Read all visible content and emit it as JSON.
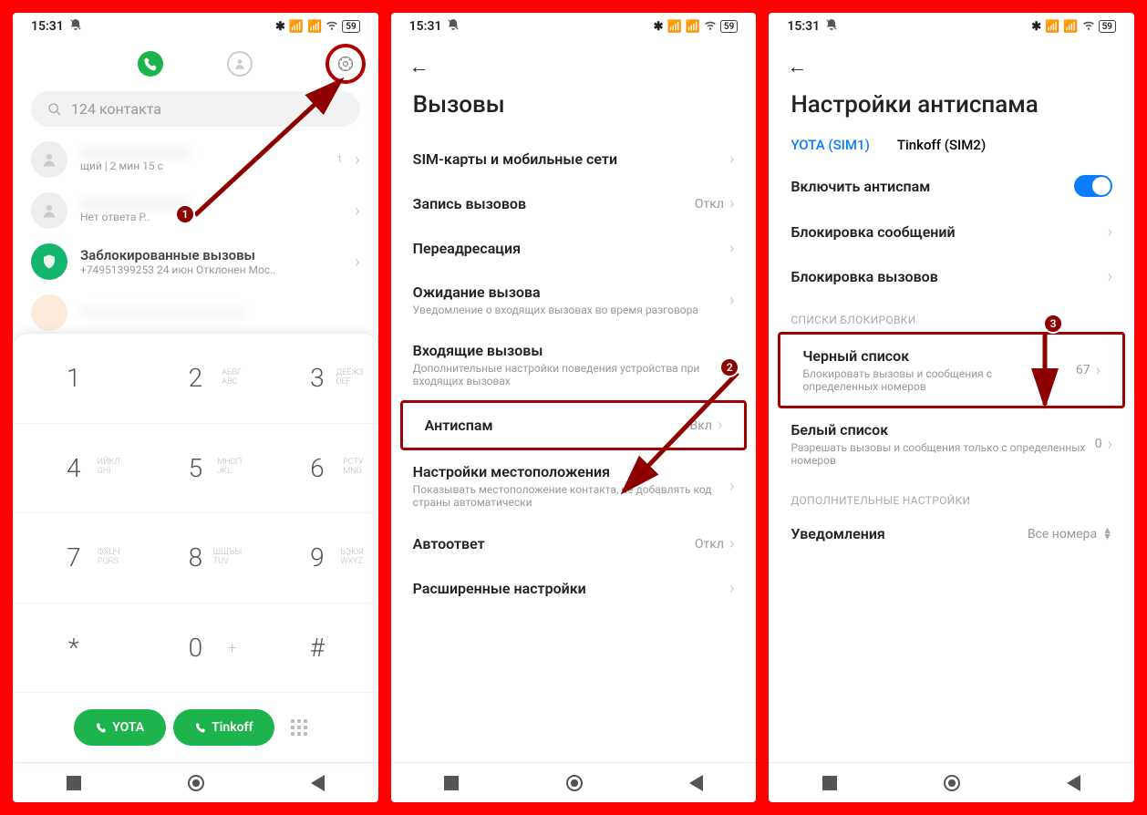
{
  "status": {
    "time": "15:31",
    "battery": "59"
  },
  "screen1": {
    "search_placeholder": "124 контакта",
    "recent1_sub": "щий | 2 мин 15 с",
    "recent2_sub": "Нет ответа  Р..",
    "blocked_title": "Заблокированные вызовы",
    "blocked_sub": "+74951399253  24 июн Отклонен  Мос..",
    "keys": [
      {
        "n": "1",
        "l": ""
      },
      {
        "n": "2",
        "l": "АБВГ\nABC"
      },
      {
        "n": "3",
        "l": "ДЕЁЖЗ\nDEF"
      },
      {
        "n": "4",
        "l": "ИЙКЛ\nGHI"
      },
      {
        "n": "5",
        "l": "МНОП\nJKL"
      },
      {
        "n": "6",
        "l": "РСТУ\nMNO"
      },
      {
        "n": "7",
        "l": "ФХЦЧ\nPQRS"
      },
      {
        "n": "8",
        "l": "ШЩЪЫ\nTUV"
      },
      {
        "n": "9",
        "l": "ЬЭЮЯ\nWXYZ"
      },
      {
        "n": "*",
        "l": ""
      },
      {
        "n": "0",
        "l": "",
        "sym": "+"
      },
      {
        "n": "#",
        "l": ""
      }
    ],
    "call_yota": "YOTA",
    "call_tinkoff": "Tinkoff"
  },
  "screen2": {
    "title": "Вызовы",
    "rows": {
      "sim": "SIM-карты и мобильные сети",
      "record": "Запись вызовов",
      "record_val": "Откл",
      "forward": "Переадресация",
      "waiting": "Ожидание вызова",
      "waiting_sub": "Уведомление о входящих вызовах во время разговора",
      "incoming": "Входящие вызовы",
      "incoming_sub": "Дополнительные настройки поведения устройства при входящих вызовах",
      "antispam": "Антиспам",
      "antispam_val": "Вкл",
      "location": "Настройки местоположения",
      "location_sub": "Показывать местоположение контакта, не добавлять код страны автоматически",
      "autoanswer": "Автоответ",
      "autoanswer_val": "Откл",
      "advanced": "Расширенные настройки"
    }
  },
  "screen3": {
    "title": "Настройки антиспама",
    "sim1": "YOTA (SIM1)",
    "sim2": "Tinkoff (SIM2)",
    "enable": "Включить антиспам",
    "block_msg": "Блокировка сообщений",
    "block_calls": "Блокировка вызовов",
    "section_lists": "СПИСКИ БЛОКИРОВКИ",
    "blacklist": "Черный список",
    "blacklist_sub": "Блокировать вызовы и сообщения с определенных номеров",
    "blacklist_val": "67",
    "whitelist": "Белый список",
    "whitelist_sub": "Разрешать вызовы и сообщения только с определенных номеров",
    "whitelist_val": "0",
    "section_extra": "ДОПОЛНИТЕЛЬНЫЕ НАСТРОЙКИ",
    "notif": "Уведомления",
    "notif_val": "Все номера"
  },
  "markers": {
    "m1": "1",
    "m2": "2",
    "m3": "3"
  }
}
